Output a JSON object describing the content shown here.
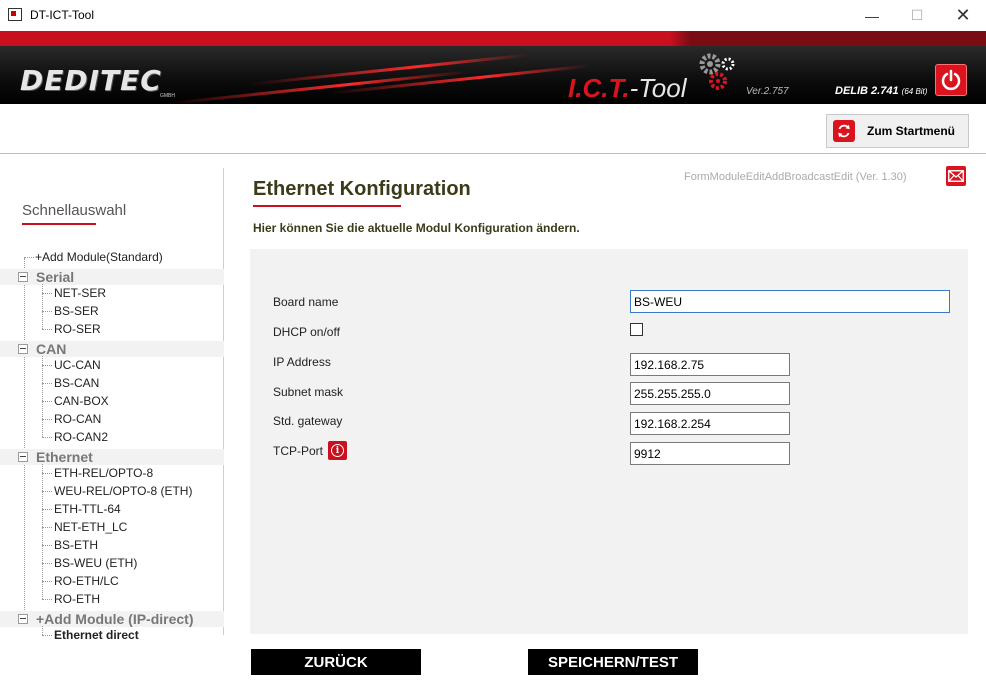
{
  "window": {
    "title": "DT-ICT-Tool",
    "controls": {
      "minimize": "—",
      "maximize": "☐",
      "close": "✕"
    }
  },
  "banner": {
    "logo": "DEDITEC",
    "logo_suffix": "GMBH",
    "ict_prefix": "I.C.T.",
    "ict_suffix": "-Tool",
    "version": "Ver.2.757",
    "delib": "DELIB 2.741",
    "delib_bits": "(64 Bit)",
    "power_icon": "power-icon"
  },
  "toolbar": {
    "start_menu_label": "Zum Startmenü",
    "start_menu_icon": "refresh-icon"
  },
  "sidebar": {
    "title": "Schnellauswahl",
    "top_item": "+Add Module(Standard)",
    "categories": [
      {
        "label": "Serial",
        "items": [
          "NET-SER",
          "BS-SER",
          "RO-SER"
        ]
      },
      {
        "label": "CAN",
        "items": [
          "UC-CAN",
          "BS-CAN",
          "CAN-BOX",
          "RO-CAN",
          "RO-CAN2"
        ]
      },
      {
        "label": "Ethernet",
        "items": [
          "ETH-REL/OPTO-8",
          "WEU-REL/OPTO-8 (ETH)",
          "ETH-TTL-64",
          "NET-ETH_LC",
          "BS-ETH",
          "BS-WEU (ETH)",
          "RO-ETH/LC",
          "RO-ETH"
        ]
      },
      {
        "label": "+Add Module (IP-direct)",
        "items": [
          "Ethernet direct"
        ]
      }
    ]
  },
  "main": {
    "title": "Ethernet Konfiguration",
    "form_info": "FormModuleEditAddBroadcastEdit (Ver. 1.30)",
    "subtitle": "Hier können Sie die aktuelle Modul Konfiguration ändern.",
    "mail_icon": "mail-icon",
    "fields": {
      "board_name": {
        "label": "Board name",
        "value": "BS-WEU"
      },
      "dhcp": {
        "label": "DHCP on/off",
        "checked": false
      },
      "ip": {
        "label": "IP Address",
        "value": "192.168.2.75"
      },
      "subnet": {
        "label": "Subnet mask",
        "value": "255.255.255.0"
      },
      "gateway": {
        "label": "Std. gateway",
        "value": "192.168.2.254"
      },
      "tcp_port": {
        "label": "TCP-Port",
        "value": "9912",
        "info_glyph": "i"
      }
    },
    "buttons": {
      "back": "ZURÜCK",
      "save": "SPEICHERN/TEST"
    }
  },
  "colors": {
    "accent_red": "#c8101e",
    "banner_black": "#0c0c0c",
    "panel_gray": "#f2f2f2"
  }
}
